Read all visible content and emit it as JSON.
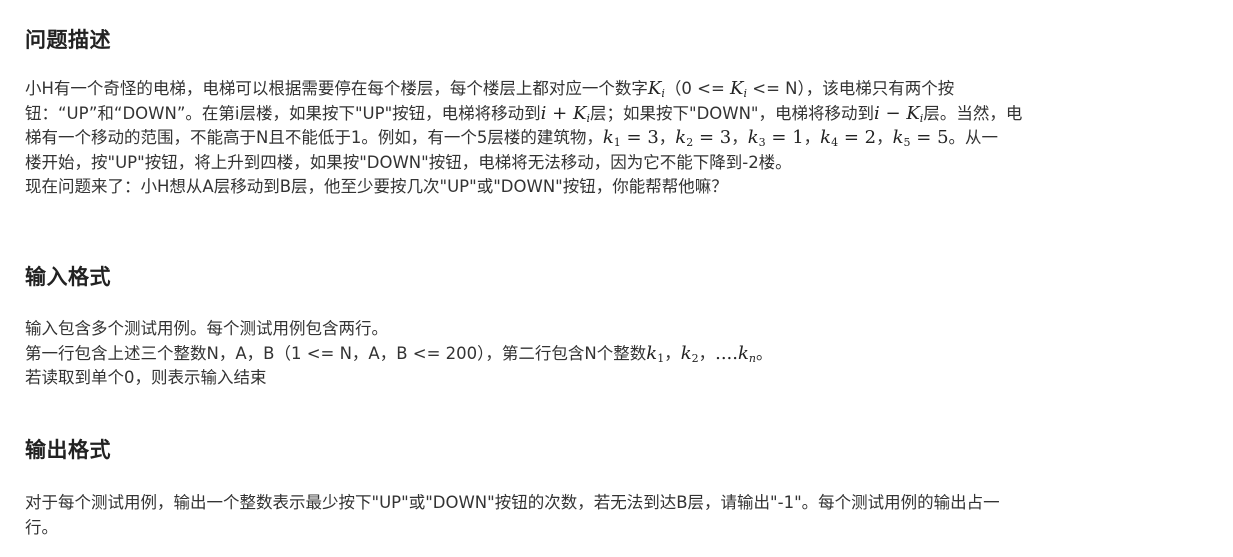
{
  "problem": {
    "heading": "问题描述",
    "line1": "小H有一个奇怪的电梯，电梯可以根据需要停在每个楼层，每个楼层上都对应一个数字",
    "line1_cond_open": "（0 <= ",
    "line1_cond_close": " <= N），该电梯只有两个按",
    "line2_a": "钮：“UP”和“DOWN”。在第i层楼，如果按下\"UP\"按钮，电梯将移动到",
    "line2_b": "层；如果按下\"DOWN\"，电梯将移动到",
    "line2_c": "层。当然，电",
    "line3_a": "梯有一个移动的范围，不能高于N且不能低于1。例如，有一个5层楼的建筑物，",
    "line3_end": "。从一",
    "line4": "楼开始，按\"UP\"按钮，将上升到四楼，如果按\"DOWN\"按钮，电梯将无法移动，因为它不能下降到-2楼。",
    "line5": "现在问题来了：小H想从A层移动到B层，他至少要按几次\"UP\"或\"DOWN\"按钮，你能帮帮他嘛？",
    "sep": "，",
    "math": {
      "K": "K",
      "i": "i",
      "plus": "+",
      "minus": "−",
      "k": "k",
      "eq": "=",
      "examples": [
        {
          "sub": "1",
          "val": "3"
        },
        {
          "sub": "2",
          "val": "3"
        },
        {
          "sub": "3",
          "val": "1"
        },
        {
          "sub": "4",
          "val": "2"
        },
        {
          "sub": "5",
          "val": "5"
        }
      ]
    }
  },
  "input": {
    "heading": "输入格式",
    "line1": "输入包含多个测试用例。每个测试用例包含两行。",
    "line2_a": "第一行包含上述三个整数N，A，B（1 <= N，A，B <= 200），第二行包含N个整数",
    "line2_sep": "，",
    "line2_dots": "....",
    "line2_end": "。",
    "line3": "若读取到单个0，则表示输入结束",
    "math": {
      "k": "k",
      "sub1": "1",
      "sub2": "2",
      "subn": "n"
    }
  },
  "output": {
    "heading": "输出格式",
    "line1": "对于每个测试用例，输出一个整数表示最少按下\"UP\"或\"DOWN\"按钮的次数，若无法到达B层，请输出\"-1\"。每个测试用例的输出占一",
    "line2": "行。"
  }
}
